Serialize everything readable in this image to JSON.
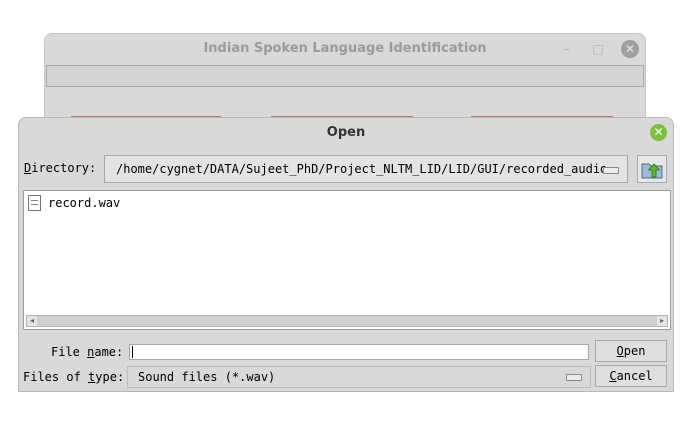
{
  "main_window": {
    "title": "Indian Spoken Language Identification",
    "minimize": "–",
    "maximize": "□",
    "close": "✕"
  },
  "dialog": {
    "title": "Open",
    "directory_label_prefix": "D",
    "directory_label_rest": "irectory:",
    "directory_value": "/home/cygnet/DATA/Sujeet_PhD/Project_NLTM_LID/LID/GUI/recorded_audio",
    "files": [
      {
        "name": "record.wav",
        "icon": "file-icon"
      }
    ],
    "file_name_label_pre": "File ",
    "file_name_label_u": "n",
    "file_name_label_post": "ame:",
    "file_name_value": "",
    "files_of_type_label_pre": "Files of ",
    "files_of_type_label_u": "t",
    "files_of_type_label_post": "ype:",
    "files_of_type_value": "Sound files (*.wav)",
    "open_button_u": "O",
    "open_button_rest": "pen",
    "cancel_button_u": "C",
    "cancel_button_rest": "ancel"
  },
  "colors": {
    "dialog_bg": "#d9d9d9",
    "close_green": "#7ac142",
    "list_bg": "#ffffff",
    "main_button_accent": "#c99a90"
  }
}
